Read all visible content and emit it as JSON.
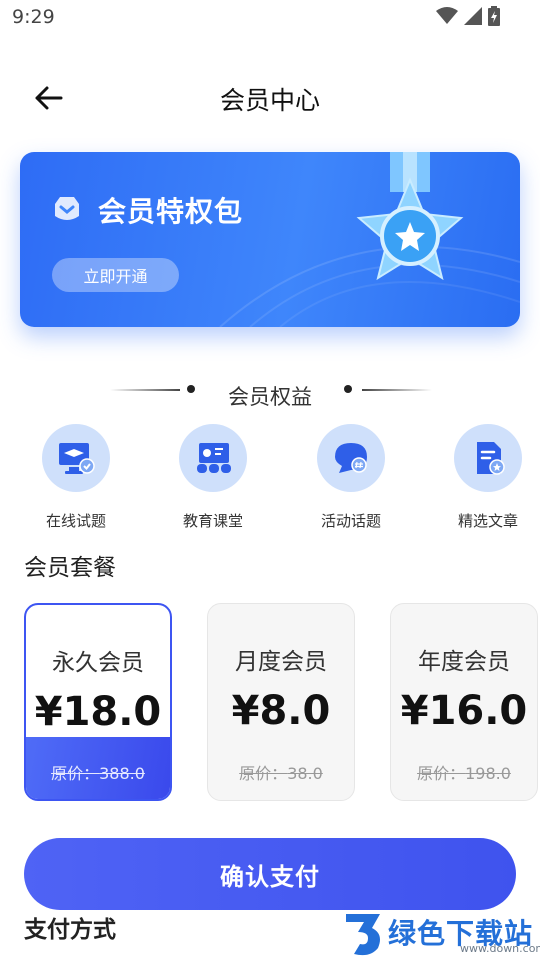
{
  "status_bar": {
    "time": "9:29"
  },
  "header": {
    "title": "会员中心"
  },
  "banner": {
    "title": "会员特权包",
    "button_label": "立即开通"
  },
  "benefits": {
    "section_title": "会员权益",
    "items": [
      {
        "label": "在线试题",
        "icon": "monitor-graduation-icon"
      },
      {
        "label": "教育课堂",
        "icon": "classroom-icon"
      },
      {
        "label": "活动话题",
        "icon": "chat-bubble-hashtag-icon"
      },
      {
        "label": "精选文章",
        "icon": "document-star-icon"
      }
    ]
  },
  "plans": {
    "section_title": "会员套餐",
    "items": [
      {
        "name": "永久会员",
        "price": "¥18.0",
        "orig_label": "原价：",
        "orig_value": "388.0",
        "selected": true
      },
      {
        "name": "月度会员",
        "price": "¥8.0",
        "orig_label": "原价：",
        "orig_value": "38.0",
        "selected": false
      },
      {
        "name": "年度会员",
        "price": "¥16.0",
        "orig_label": "原价：",
        "orig_value": "198.0",
        "selected": false
      }
    ]
  },
  "pay_button": {
    "label": "确认支付"
  },
  "payment_method": {
    "title": "支付方式"
  },
  "watermark": {
    "text": "绿色下载站",
    "url": "www.down.com"
  },
  "colors": {
    "accent": "#3f53ee",
    "banner_blue": "#3f86fb",
    "icon_circle": "#cfe0fb"
  }
}
